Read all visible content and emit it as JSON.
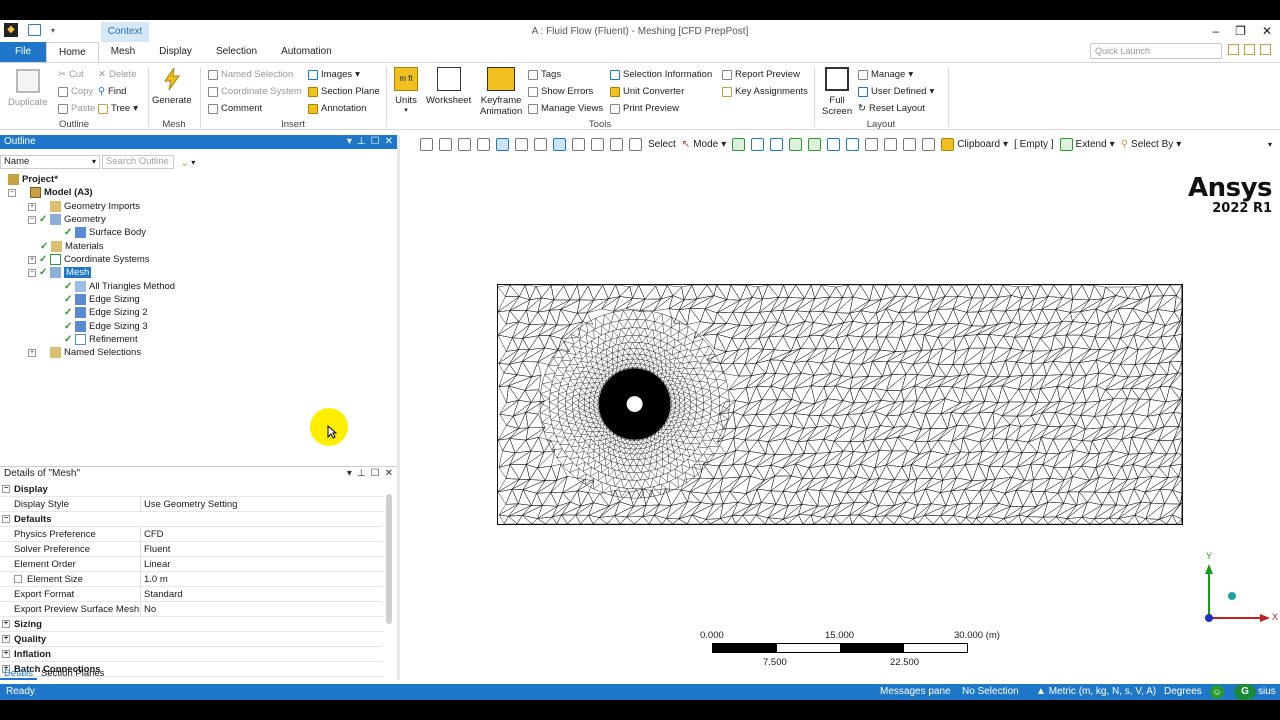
{
  "window": {
    "title": "A : Fluid Flow (Fluent) - Meshing [CFD PrepPost]",
    "context_tab": "Context",
    "controls": [
      "–",
      "❐",
      "✕"
    ]
  },
  "ribbon_tabs": [
    "File",
    "Home",
    "Mesh",
    "Display",
    "Selection",
    "Automation"
  ],
  "active_tab": "Home",
  "quick_launch": {
    "placeholder": "Quick Launch"
  },
  "ribbon": {
    "outline": {
      "label": "Outline",
      "duplicate": "Duplicate",
      "cut": "Cut",
      "copy": "Copy",
      "paste": "Paste",
      "delete": "Delete",
      "find": "Find",
      "tree": "Tree"
    },
    "mesh": {
      "label": "Mesh",
      "generate": "Generate"
    },
    "insert": {
      "label": "Insert",
      "named_selection": "Named Selection",
      "coordinate_system": "Coordinate System",
      "comment": "Comment",
      "images": "Images",
      "section_plane": "Section Plane",
      "annotation": "Annotation"
    },
    "tools": {
      "label": "Tools",
      "units": "Units",
      "worksheet": "Worksheet",
      "keyframe1": "Keyframe",
      "keyframe2": "Animation",
      "tags": "Tags",
      "show_errors": "Show Errors",
      "manage_views": "Manage Views",
      "selection_information": "Selection Information",
      "unit_converter": "Unit Converter",
      "print_preview": "Print Preview",
      "report_preview": "Report Preview",
      "key_assignments": "Key Assignments"
    },
    "layout": {
      "label": "Layout",
      "full1": "Full",
      "full2": "Screen",
      "manage": "Manage",
      "user_defined": "User Defined",
      "reset_layout": "Reset Layout"
    }
  },
  "outline_panel": {
    "title": "Outline",
    "name_filter": "Name",
    "search_placeholder": "Search Outline"
  },
  "tree": {
    "project": "Project*",
    "model": "Model (A3)",
    "geometry_imports": "Geometry Imports",
    "geometry": "Geometry",
    "surface_body": "Surface Body",
    "materials": "Materials",
    "coordinate_systems": "Coordinate Systems",
    "mesh": "Mesh",
    "all_triangles": "All Triangles Method",
    "edge_sizing": "Edge Sizing",
    "edge_sizing_2": "Edge Sizing 2",
    "edge_sizing_3": "Edge Sizing 3",
    "refinement": "Refinement",
    "named_selections": "Named Selections"
  },
  "details": {
    "title": "Details of \"Mesh\"",
    "rows": [
      {
        "cat": true,
        "k": "Display",
        "v": ""
      },
      {
        "cat": false,
        "k": "Display Style",
        "v": "Use Geometry Setting"
      },
      {
        "cat": true,
        "k": "Defaults",
        "v": ""
      },
      {
        "cat": false,
        "k": "Physics Preference",
        "v": "CFD"
      },
      {
        "cat": false,
        "k": "Solver Preference",
        "v": "Fluent"
      },
      {
        "cat": false,
        "k": "Element Order",
        "v": "Linear"
      },
      {
        "cat": false,
        "k": "Element Size",
        "v": "1.0 m"
      },
      {
        "cat": false,
        "k": "Export Format",
        "v": "Standard"
      },
      {
        "cat": false,
        "k": "Export Preview Surface Mesh",
        "v": "No"
      },
      {
        "cat": true,
        "k": "Sizing",
        "v": ""
      },
      {
        "cat": true,
        "k": "Quality",
        "v": ""
      },
      {
        "cat": true,
        "k": "Inflation",
        "v": ""
      },
      {
        "cat": true,
        "k": "Batch Connections",
        "v": ""
      }
    ],
    "tabs": [
      "Details",
      "Section Planes"
    ]
  },
  "graphics_toolbar": {
    "select": "Select",
    "mode": "Mode",
    "clipboard": "Clipboard",
    "empty": "[ Empty ]",
    "extend": "Extend",
    "select_by": "Select By"
  },
  "brand": {
    "name": "Ansys",
    "version": "2022 R1"
  },
  "scale_bar": {
    "top": [
      "0.000",
      "15.000",
      "30.000 (m)"
    ],
    "bottom": [
      "7.500",
      "22.500"
    ]
  },
  "triad": {
    "y": "Y",
    "x": "X"
  },
  "status": {
    "ready": "Ready",
    "messages": "Messages pane",
    "selection": "No Selection",
    "units": "Metric (m, kg, N, s, V, A)",
    "degrees": "Degrees",
    "celsius": "sius"
  },
  "colors": {
    "accent": "#1f77c9",
    "status_bar": "#1f77c9",
    "cursor_highlight": "#ffee00"
  }
}
